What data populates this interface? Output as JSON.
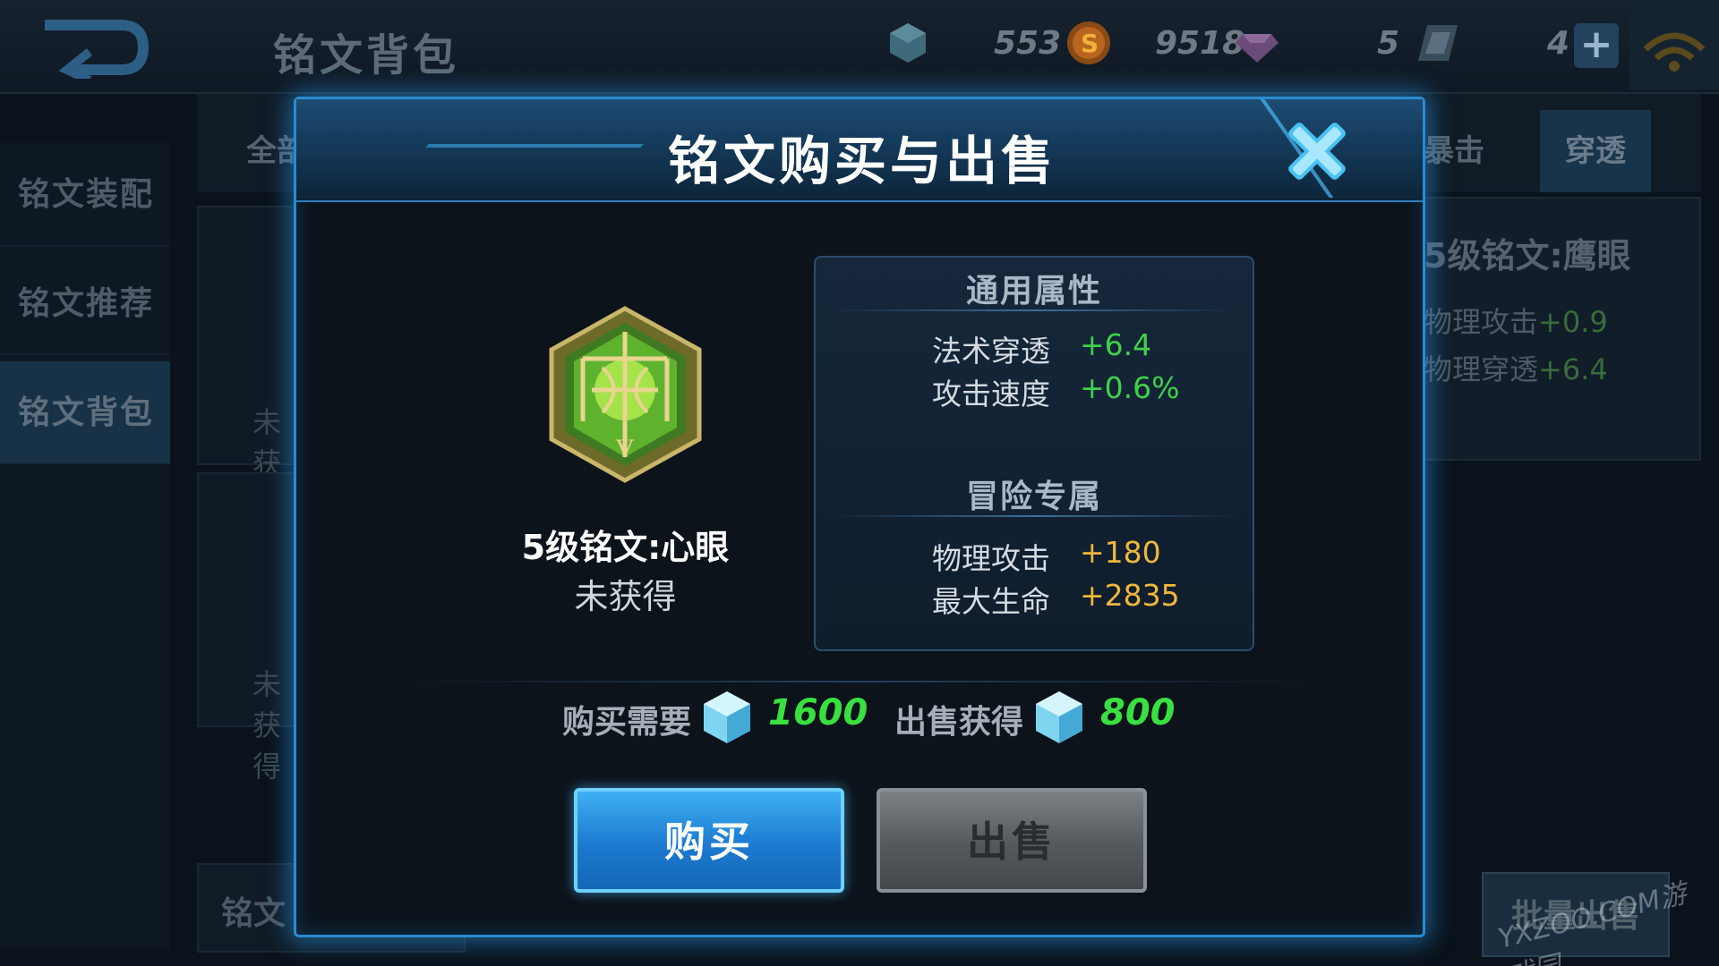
{
  "topbar": {
    "title": "铭文背包",
    "resources": [
      "553",
      "9518",
      "5",
      "4"
    ],
    "plus_label": "+"
  },
  "sidebar": {
    "items": [
      {
        "label": "铭文装配"
      },
      {
        "label": "铭文推荐"
      },
      {
        "label": "铭文背包"
      }
    ]
  },
  "bg_tabs": {
    "first_partial": "全部",
    "crit": "暴击",
    "penetration": "穿透"
  },
  "bg_cards": {
    "status": "未获得"
  },
  "bg_panel": {
    "title": "5级铭文:鹰眼",
    "line1_name": "物理攻击",
    "line1_value": "+0.9",
    "line2_name": "物理穿透",
    "line2_value": "+6.4"
  },
  "bg_bottom": {
    "label": "铭文",
    "batch_sell": "批量出售"
  },
  "watermark": "YXZOO.COM游戏园",
  "dialog": {
    "title": "铭文购买与出售",
    "rune": {
      "name": "5级铭文:心眼",
      "status": "未获得",
      "level_mark": "V"
    },
    "general": {
      "heading": "通用属性",
      "attrs": [
        {
          "name": "法术穿透",
          "value": "+6.4"
        },
        {
          "name": "攻击速度",
          "value": "+0.6%"
        }
      ]
    },
    "adventure": {
      "heading": "冒险专属",
      "attrs": [
        {
          "name": "物理攻击",
          "value": "+180"
        },
        {
          "name": "最大生命",
          "value": "+2835"
        }
      ]
    },
    "buy_cost_label": "购买需要",
    "buy_cost": "1600",
    "sell_gain_label": "出售获得",
    "sell_gain": "800",
    "buy_button": "购买",
    "sell_button": "出售"
  },
  "colors": {
    "accent_blue": "#2b8bd0",
    "green_value": "#3fd14a",
    "gold_value": "#f0b73c",
    "price_green": "#39e040"
  }
}
